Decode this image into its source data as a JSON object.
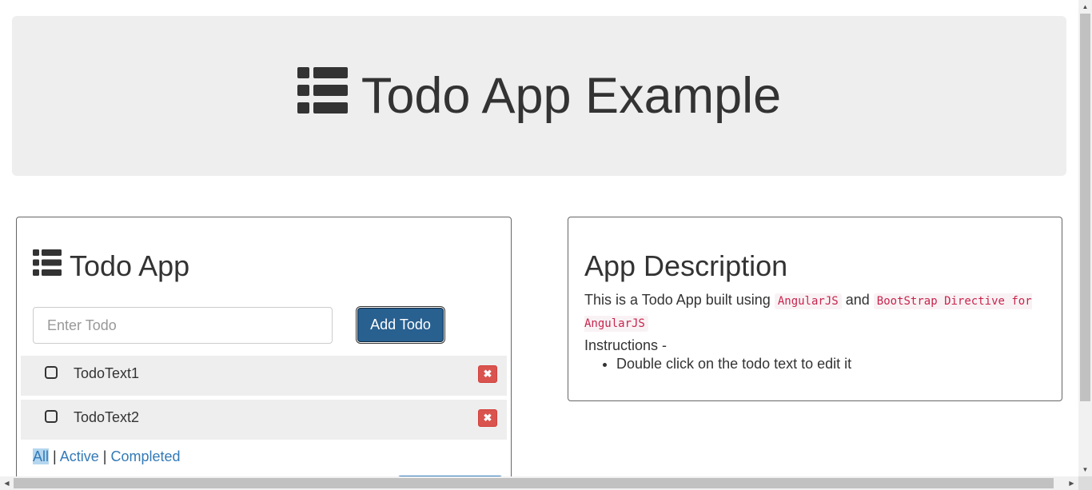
{
  "header": {
    "icon": "th-list-icon",
    "title": "Todo App Example"
  },
  "todo_panel": {
    "icon": "th-list-icon",
    "title": "Todo App",
    "input": {
      "placeholder": "Enter Todo",
      "value": ""
    },
    "add_button_label": "Add Todo",
    "todos": [
      {
        "text": "TodoText1",
        "completed": false
      },
      {
        "text": "TodoText2",
        "completed": false
      }
    ],
    "delete_glyph": "✖",
    "filters": {
      "all": "All",
      "active": "Active",
      "completed": "Completed",
      "separator": "|",
      "selected": "All"
    }
  },
  "description_panel": {
    "title": "App Description",
    "text_prefix": "This is a Todo App built using",
    "code1": "AngularJS",
    "text_mid": "and",
    "code2": "BootStrap Directive for AngularJS",
    "instructions_label": "Instructions -",
    "instructions": [
      "Double click on the todo text to edit it"
    ]
  },
  "colors": {
    "jumbotron_bg": "#eeeeee",
    "primary": "#286090",
    "danger": "#d9534f",
    "link": "#337ab7",
    "code": "#c7254e"
  }
}
